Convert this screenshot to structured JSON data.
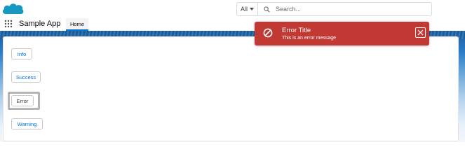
{
  "header": {
    "logo_icon": "salesforce-cloud-icon",
    "search": {
      "scope_label": "All",
      "placeholder": "Search...",
      "value": ""
    }
  },
  "nav": {
    "launcher_icon": "app-launcher-grid-icon",
    "app_name": "Sample App",
    "tabs": [
      {
        "label": "Home",
        "active": true
      }
    ]
  },
  "main": {
    "buttons": [
      {
        "label": "Info"
      },
      {
        "label": "Success"
      },
      {
        "label": "Error",
        "focused": true
      },
      {
        "label": "Warning"
      }
    ]
  },
  "toast": {
    "variant": "error",
    "icon": "ban-icon",
    "title": "Error Title",
    "message": "This is an error message",
    "close_icon": "close-icon"
  },
  "colors": {
    "brand": "#0070d2",
    "logo": "#1798c1",
    "toast_error": "#c23934",
    "band": "#2a7bc4"
  }
}
